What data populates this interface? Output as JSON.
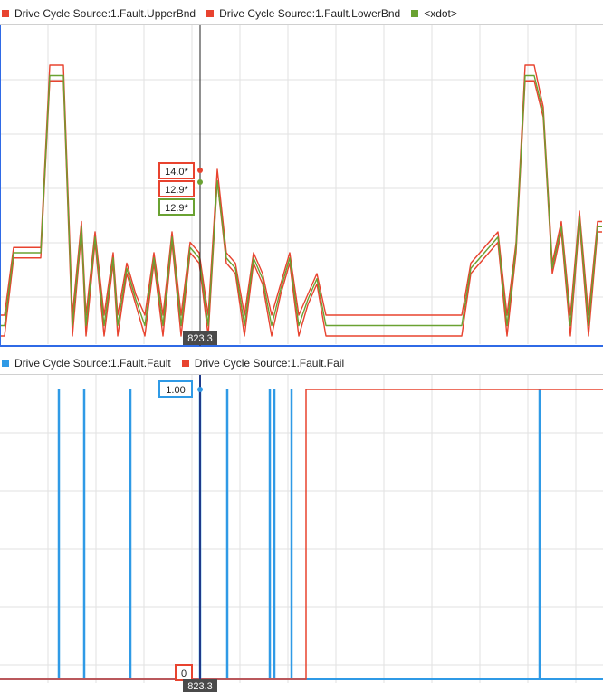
{
  "legend_top": [
    {
      "label": "Drive Cycle Source:1.Fault.UpperBnd",
      "color": "#e8432f"
    },
    {
      "label": "Drive Cycle Source:1.Fault.LowerBnd",
      "color": "#e8432f"
    },
    {
      "label": "<xdot>",
      "color": "#6aa232"
    }
  ],
  "legend_bottom": [
    {
      "label": "Drive Cycle Source:1.Fault.Fault",
      "color": "#2f9ae6"
    },
    {
      "label": "Drive Cycle Source:1.Fault.Fail",
      "color": "#e8432f"
    }
  ],
  "cursor": {
    "time_label": "823.3",
    "top_values": {
      "upper": "14.0*",
      "lower": "12.9*",
      "xdot": "12.9*"
    },
    "bottom_values": {
      "fault": "1.00",
      "fail": "0"
    }
  },
  "chart_data": [
    {
      "type": "line",
      "title": "",
      "xlabel": "",
      "ylabel": "",
      "grid": true,
      "legend": "top-left",
      "series": [
        {
          "name": "Drive Cycle Source:1.Fault.UpperBnd",
          "color": "#e8432f",
          "x": [
            0,
            5,
            15,
            25,
            35,
            45,
            55,
            65,
            70,
            80,
            90,
            95,
            105,
            115,
            125,
            130,
            140,
            150,
            160,
            170,
            180,
            190,
            200,
            210,
            220,
            230,
            240,
            250,
            260,
            270,
            280,
            290,
            300,
            310,
            320,
            330,
            340,
            350,
            360,
            370,
            380,
            390,
            400,
            410,
            420,
            430,
            440,
            450,
            460,
            470,
            480,
            490,
            500,
            510,
            520,
            530,
            540,
            550,
            560,
            570,
            580,
            590,
            600,
            610,
            620,
            630,
            640,
            650,
            660,
            665
          ],
          "y": [
            0,
            0,
            6.5,
            6.5,
            6.5,
            6.5,
            24,
            24,
            24,
            0,
            9,
            0,
            8,
            0,
            6,
            0,
            5,
            2,
            0,
            6,
            0,
            8,
            0,
            7,
            6,
            0,
            14,
            6,
            5,
            0,
            6,
            4,
            0,
            3,
            6,
            0,
            2,
            4,
            0,
            0,
            0,
            0,
            0,
            0,
            0,
            0,
            0,
            0,
            0,
            0,
            0,
            0,
            0,
            0,
            5,
            6,
            7,
            8,
            0,
            7,
            24,
            24,
            20,
            5,
            9,
            0,
            10,
            0,
            9,
            9
          ]
        },
        {
          "name": "Drive Cycle Source:1.Fault.LowerBnd",
          "color": "#e8432f",
          "x": [
            0,
            5,
            15,
            25,
            35,
            45,
            55,
            65,
            70,
            80,
            90,
            95,
            105,
            115,
            125,
            130,
            140,
            150,
            160,
            170,
            180,
            190,
            200,
            210,
            220,
            230,
            240,
            250,
            260,
            270,
            280,
            290,
            300,
            310,
            320,
            330,
            340,
            350,
            360,
            370,
            380,
            390,
            400,
            410,
            420,
            430,
            440,
            450,
            460,
            470,
            480,
            490,
            500,
            510,
            520,
            530,
            540,
            550,
            560,
            570,
            580,
            590,
            600,
            610,
            620,
            630,
            640,
            650,
            660,
            665
          ],
          "y": [
            -2,
            -2,
            5.5,
            5.5,
            5.5,
            5.5,
            22.5,
            22.5,
            22.5,
            -2,
            8,
            -2,
            7,
            -2,
            5,
            -2,
            4,
            1,
            -2,
            5,
            -2,
            7,
            -2,
            6,
            5,
            -2,
            12.9,
            5,
            4,
            -2,
            5,
            3,
            -2,
            2,
            5,
            -2,
            1,
            3,
            -2,
            -2,
            -2,
            -2,
            -2,
            -2,
            -2,
            -2,
            -2,
            -2,
            -2,
            -2,
            -2,
            -2,
            -2,
            -2,
            4,
            5,
            6,
            7,
            -2,
            6,
            22.5,
            22.5,
            19,
            4,
            8,
            -2,
            9,
            -2,
            8,
            8
          ]
        },
        {
          "name": "<xdot>",
          "color": "#6aa232",
          "x": [
            0,
            5,
            15,
            25,
            35,
            45,
            55,
            65,
            70,
            80,
            90,
            95,
            105,
            115,
            125,
            130,
            140,
            150,
            160,
            170,
            180,
            190,
            200,
            210,
            220,
            230,
            240,
            250,
            260,
            270,
            280,
            290,
            300,
            310,
            320,
            330,
            340,
            350,
            360,
            370,
            380,
            390,
            400,
            410,
            420,
            430,
            440,
            450,
            460,
            470,
            480,
            490,
            500,
            510,
            520,
            530,
            540,
            550,
            560,
            570,
            580,
            590,
            600,
            610,
            620,
            630,
            640,
            650,
            660,
            665
          ],
          "y": [
            -1,
            -1,
            6,
            6,
            6,
            6,
            23,
            23,
            23,
            -1,
            8.5,
            -1,
            7.5,
            -1,
            5.5,
            -1,
            4.5,
            1.5,
            -1,
            5.5,
            -1,
            7.5,
            -1,
            6.5,
            5.5,
            -1,
            12.9,
            5.5,
            4.5,
            -1,
            5.5,
            3.5,
            -1,
            2.5,
            5.5,
            -1,
            1.5,
            3.5,
            -1,
            -1,
            -1,
            -1,
            -1,
            -1,
            -1,
            -1,
            -1,
            -1,
            -1,
            -1,
            -1,
            -1,
            -1,
            -1,
            4.5,
            5.5,
            6.5,
            7.5,
            -1,
            6.5,
            23,
            23,
            19.5,
            4.5,
            8.5,
            -1,
            9.5,
            -1,
            8.5,
            8.5
          ]
        }
      ]
    },
    {
      "type": "line",
      "title": "",
      "xlabel": "",
      "ylabel": "",
      "grid": true,
      "legend": "top-left",
      "series": [
        {
          "name": "Drive Cycle Source:1.Fault.Fault",
          "color": "#2f9ae6",
          "pulses_x": [
            65,
            93,
            144,
            221,
            251,
            298,
            303,
            322,
            596
          ]
        },
        {
          "name": "Drive Cycle Source:1.Fault.Fail",
          "color": "#e8432f",
          "step_x": 338
        }
      ]
    }
  ]
}
